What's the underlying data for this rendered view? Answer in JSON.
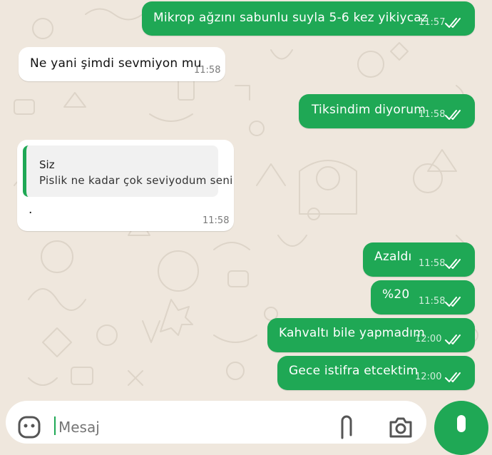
{
  "chat": {
    "messages": [
      {
        "direction": "out",
        "text": "Mikrop ağzını sabunlu suyla 5-6 kez yikiycaz",
        "time": "11:57",
        "status": "read"
      },
      {
        "direction": "in",
        "text": "Ne yani şimdi sevmiyon mu",
        "time": "11:58"
      },
      {
        "direction": "out",
        "text": "Tiksindim diyorum",
        "time": "11:58",
        "status": "read"
      },
      {
        "direction": "in",
        "reply_to": {
          "author": "Siz",
          "text": "Pislik ne kadar çok seviyodum seni"
        },
        "text": ".",
        "time": "11:58"
      },
      {
        "direction": "out",
        "text": "Azaldı",
        "time": "11:58",
        "status": "read"
      },
      {
        "direction": "out",
        "text": "%20",
        "time": "11:58",
        "status": "read"
      },
      {
        "direction": "out",
        "text": "Kahvaltı bile yapmadım",
        "time": "12:00",
        "status": "read"
      },
      {
        "direction": "out",
        "text": "Gece istifra etcektim",
        "time": "12:00",
        "status": "read"
      }
    ]
  },
  "composer": {
    "placeholder": "Mesaj",
    "icons": [
      "emoji-icon",
      "attach-icon",
      "camera-icon",
      "mic-icon"
    ]
  },
  "colors": {
    "outgoing_bubble": "#1fa855",
    "incoming_bubble": "#ffffff",
    "wallpaper": "#efe7dd",
    "mic_button": "#1fa855"
  }
}
